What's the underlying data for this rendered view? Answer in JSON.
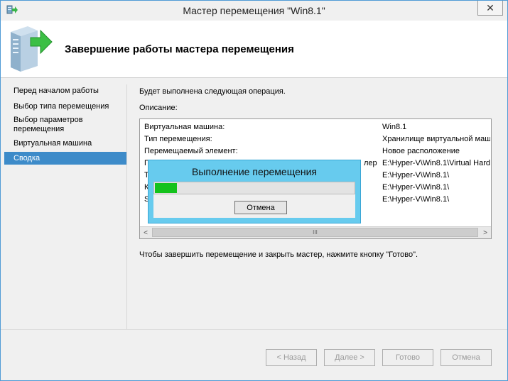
{
  "window": {
    "title": "Мастер перемещения \"Win8.1\"",
    "close_glyph": "✕"
  },
  "header": {
    "title": "Завершение работы мастера перемещения"
  },
  "sidebar": {
    "items": [
      {
        "label": "Перед началом работы"
      },
      {
        "label": "Выбор типа перемещения"
      },
      {
        "label": "Выбор параметров перемещения"
      },
      {
        "label": "Виртуальная машина"
      },
      {
        "label": "Сводка"
      }
    ]
  },
  "main": {
    "intro": "Будет выполнена следующая операция.",
    "description_label": "Описание:",
    "rows": [
      {
        "key": "Виртуальная машина:",
        "value": "Win8.1"
      },
      {
        "key": "Тип перемещения:",
        "value": "Хранилище виртуальной маши"
      },
      {
        "key": "Перемещаемый элемент:",
        "value": "Новое расположение"
      },
      {
        "key": "П",
        "key_suffix": "лер",
        "value": "E:\\Hyper-V\\Win8.1\\Virtual Hard"
      },
      {
        "key": "Т",
        "value": "E:\\Hyper-V\\Win8.1\\"
      },
      {
        "key": "К",
        "value": "E:\\Hyper-V\\Win8.1\\"
      },
      {
        "key": "S",
        "value": "E:\\Hyper-V\\Win8.1\\"
      }
    ],
    "footer_text": "Чтобы завершить перемещение и закрыть мастер, нажмите кнопку \"Готово\"."
  },
  "progress": {
    "title": "Выполнение перемещения",
    "cancel_label": "Отмена",
    "fraction": 0.11
  },
  "scroll": {
    "left": "<",
    "right": ">",
    "thumb_grip": "III"
  },
  "buttons": {
    "back": "< Назад",
    "next": "Далее >",
    "finish": "Готово",
    "cancel": "Отмена"
  }
}
